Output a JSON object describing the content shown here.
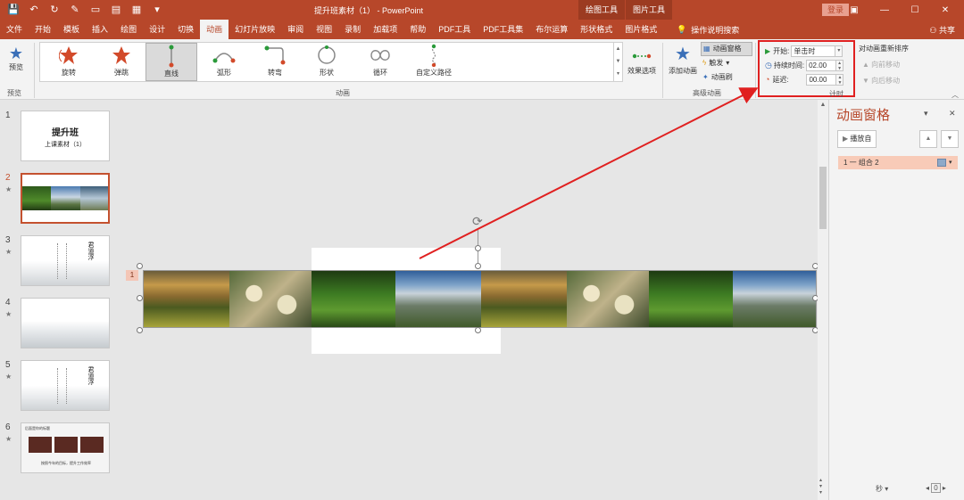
{
  "window": {
    "title": "提升班素材（1） - PowerPoint",
    "context_tabs": [
      "绘图工具",
      "图片工具"
    ],
    "login": "登录",
    "share": "共享"
  },
  "tabs": [
    {
      "label": "文件"
    },
    {
      "label": "开始"
    },
    {
      "label": "模板"
    },
    {
      "label": "插入"
    },
    {
      "label": "绘图"
    },
    {
      "label": "设计"
    },
    {
      "label": "切换"
    },
    {
      "label": "动画"
    },
    {
      "label": "幻灯片放映"
    },
    {
      "label": "审阅"
    },
    {
      "label": "视图"
    },
    {
      "label": "录制"
    },
    {
      "label": "加载项"
    },
    {
      "label": "帮助"
    },
    {
      "label": "PDF工具"
    },
    {
      "label": "PDF工具集"
    },
    {
      "label": "布尔运算"
    },
    {
      "label": "形状格式"
    },
    {
      "label": "图片格式"
    }
  ],
  "active_tab": "动画",
  "tell_me": "操作说明搜索",
  "ribbon": {
    "preview": {
      "label": "预览",
      "group": "预览"
    },
    "animations": [
      {
        "label": "旋转",
        "icon": "star-spin-icon"
      },
      {
        "label": "弹跳",
        "icon": "star-bounce-icon"
      },
      {
        "label": "直线",
        "icon": "line-path-icon"
      },
      {
        "label": "弧形",
        "icon": "arc-path-icon"
      },
      {
        "label": "转弯",
        "icon": "turn-path-icon"
      },
      {
        "label": "形状",
        "icon": "shape-path-icon"
      },
      {
        "label": "循环",
        "icon": "loop-path-icon"
      },
      {
        "label": "自定义路径",
        "icon": "custom-path-icon"
      }
    ],
    "selected_animation": "直线",
    "animations_group": "动画",
    "effect_options": "效果选项",
    "add_animation": "添加动画",
    "advanced": {
      "items": [
        "动画窗格",
        "触发",
        "动画刷"
      ],
      "group": "高级动画"
    },
    "timing": {
      "start_label": "开始:",
      "start_value": "单击时",
      "duration_label": "持续时间:",
      "duration_value": "02.00",
      "delay_label": "延迟:",
      "delay_value": "00.00",
      "group": "计时"
    },
    "reorder": {
      "title": "对动画重新排序",
      "earlier": "向前移动",
      "later": "向后移动"
    }
  },
  "slides": [
    {
      "num": "1",
      "title": "提升班",
      "subtitle": "上课素材（1）",
      "star": ""
    },
    {
      "num": "2",
      "star": "★"
    },
    {
      "num": "3",
      "star": "★",
      "poem": "君道浮"
    },
    {
      "num": "4",
      "star": "★"
    },
    {
      "num": "5",
      "star": "★",
      "poem": "君道浮"
    },
    {
      "num": "6",
      "star": "★",
      "title": "后面是你的标题",
      "footer": "按照今年的目标，提升工作效率"
    }
  ],
  "canvas": {
    "animation_tag": "1"
  },
  "pane": {
    "title": "动画窗格",
    "play": "播放自",
    "item": "1 一 组合 2",
    "bottom_seconds": "秒",
    "zoom": "0"
  },
  "colors": {
    "accent": "#b7472a",
    "highlight": "#e02020"
  }
}
